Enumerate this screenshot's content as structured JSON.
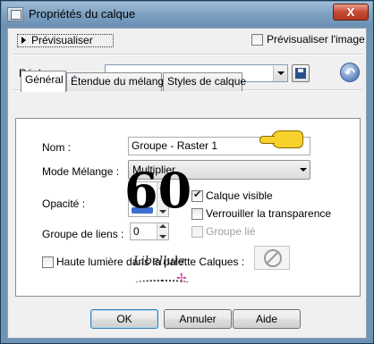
{
  "window": {
    "title": "Propriétés du calque",
    "close_label": "X"
  },
  "top": {
    "preview_button": "Prévisualiser",
    "preview_image_label": "Prévisualiser l'image",
    "preview_image_checked": false
  },
  "presets": {
    "label": "Réglages",
    "value": ""
  },
  "tabs": [
    {
      "label": "Général",
      "active": true
    },
    {
      "label": "Étendue du mélange",
      "active": false
    },
    {
      "label": "Styles de calque",
      "active": false
    }
  ],
  "general": {
    "name_label": "Nom :",
    "name_value": "Groupe - Raster 1",
    "blend_label": "Mode Mélange :",
    "blend_value": "Multiplier",
    "opacity_label": "Opacité :",
    "opacity_value": 60,
    "opacity_display": "60",
    "group_label": "Groupe de liens :",
    "group_value": "0",
    "visible_label": "Calque visible",
    "visible_checked": true,
    "lock_label": "Verrouiller la transparence",
    "lock_checked": false,
    "linked_label": "Groupe lié",
    "linked_checked": false,
    "highlight_label": "Haute lumière dans la palette Calques :",
    "highlight_checked": false
  },
  "watermark_text": "Libellule",
  "buttons": {
    "ok": "OK",
    "cancel": "Annuler",
    "help": "Aide"
  },
  "colors": {
    "title_bar": "#7b9fc0",
    "accent": "#3a6fd0",
    "hand": "#f8d22a"
  }
}
